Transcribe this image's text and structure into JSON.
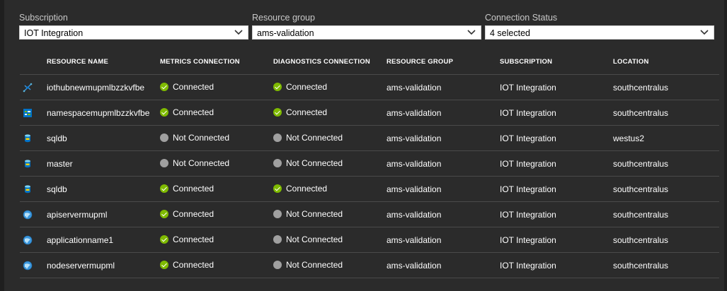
{
  "filters": [
    {
      "label": "Subscription",
      "value": "IOT Integration"
    },
    {
      "label": "Resource group",
      "value": "ams-validation"
    },
    {
      "label": "Connection Status",
      "value": "4 selected"
    }
  ],
  "columns": [
    "RESOURCE NAME",
    "METRICS CONNECTION",
    "DIAGNOSTICS CONNECTION",
    "RESOURCE GROUP",
    "SUBSCRIPTION",
    "LOCATION"
  ],
  "rows": [
    {
      "icon": "iot-hub-icon",
      "name": "iothubnewmupmlbzzkvfbe",
      "metrics": "Connected",
      "metrics_ok": true,
      "diagnostics": "Connected",
      "diagnostics_ok": true,
      "group": "ams-validation",
      "subscription": "IOT Integration",
      "location": "southcentralus"
    },
    {
      "icon": "event-hub-namespace-icon",
      "name": "namespacemupmlbzzkvfbe",
      "metrics": "Connected",
      "metrics_ok": true,
      "diagnostics": "Connected",
      "diagnostics_ok": true,
      "group": "ams-validation",
      "subscription": "IOT Integration",
      "location": "southcentralus"
    },
    {
      "icon": "sql-database-icon",
      "name": "sqldb",
      "metrics": "Not Connected",
      "metrics_ok": false,
      "diagnostics": "Not Connected",
      "diagnostics_ok": false,
      "group": "ams-validation",
      "subscription": "IOT Integration",
      "location": "westus2"
    },
    {
      "icon": "sql-database-icon",
      "name": "master",
      "metrics": "Not Connected",
      "metrics_ok": false,
      "diagnostics": "Not Connected",
      "diagnostics_ok": false,
      "group": "ams-validation",
      "subscription": "IOT Integration",
      "location": "southcentralus"
    },
    {
      "icon": "sql-database-icon",
      "name": "sqldb",
      "metrics": "Connected",
      "metrics_ok": true,
      "diagnostics": "Connected",
      "diagnostics_ok": true,
      "group": "ams-validation",
      "subscription": "IOT Integration",
      "location": "southcentralus"
    },
    {
      "icon": "web-app-icon",
      "name": "apiservermupml",
      "metrics": "Connected",
      "metrics_ok": true,
      "diagnostics": "Not Connected",
      "diagnostics_ok": false,
      "group": "ams-validation",
      "subscription": "IOT Integration",
      "location": "southcentralus"
    },
    {
      "icon": "web-app-icon",
      "name": "applicationname1",
      "metrics": "Connected",
      "metrics_ok": true,
      "diagnostics": "Not Connected",
      "diagnostics_ok": false,
      "group": "ams-validation",
      "subscription": "IOT Integration",
      "location": "southcentralus"
    },
    {
      "icon": "web-app-icon",
      "name": "nodeservermupml",
      "metrics": "Connected",
      "metrics_ok": true,
      "diagnostics": "Not Connected",
      "diagnostics_ok": false,
      "group": "ams-validation",
      "subscription": "IOT Integration",
      "location": "southcentralus"
    }
  ],
  "colors": {
    "background": "#2b2b2b",
    "connected": "#7fba00",
    "not_connected": "#a0a0a0",
    "azure_blue": "#0078d7"
  }
}
